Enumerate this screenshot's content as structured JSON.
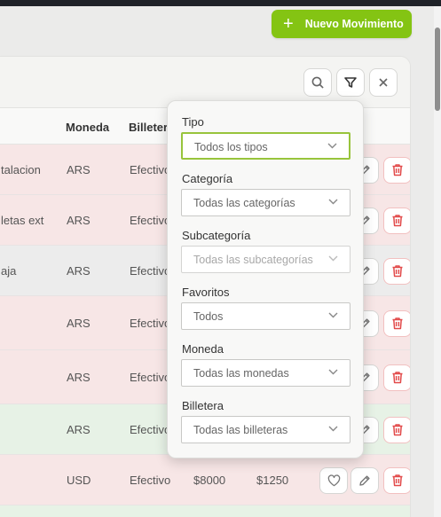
{
  "header": {
    "new_button_label": "Nuevo Movimiento"
  },
  "toolbar": {
    "icons": [
      "search-icon",
      "filter-icon",
      "close-icon"
    ]
  },
  "table": {
    "columns": [
      "Moneda",
      "Billetera"
    ],
    "rows": [
      {
        "desc": "talacion",
        "moneda": "ARS",
        "billetera": "Efectivo",
        "type": "expense"
      },
      {
        "desc": "letas ext",
        "moneda": "ARS",
        "billetera": "Efectivo",
        "type": "expense"
      },
      {
        "desc": "aja",
        "moneda": "ARS",
        "billetera": "Efectivo",
        "type": "neutral"
      },
      {
        "desc": "",
        "moneda": "ARS",
        "billetera": "Efectivo",
        "type": "expense"
      },
      {
        "desc": "",
        "moneda": "ARS",
        "billetera": "Efectivo",
        "type": "expense"
      },
      {
        "desc": "",
        "moneda": "ARS",
        "billetera": "Efectivo",
        "type": "income"
      },
      {
        "desc": "",
        "moneda": "USD",
        "billetera": "Efectivo",
        "amount1": "$8000",
        "amount2": "$1250",
        "type": "expense"
      },
      {
        "desc": "",
        "moneda": "",
        "billetera": "",
        "type": "income"
      }
    ]
  },
  "filters": {
    "tipo": {
      "label": "Tipo",
      "value": "Todos los tipos"
    },
    "categoria": {
      "label": "Categoría",
      "value": "Todas las categorías"
    },
    "subcategoria": {
      "label": "Subcategoría",
      "value": "Todas las subcategorías"
    },
    "favoritos": {
      "label": "Favoritos",
      "value": "Todos"
    },
    "moneda": {
      "label": "Moneda",
      "value": "Todas las monedas"
    },
    "billetera": {
      "label": "Billetera",
      "value": "Todas las billeteras"
    }
  },
  "colors": {
    "accent": "#84c413",
    "expense_row": "#f7e6e6",
    "income_row": "#e7f2e6",
    "neutral_row": "#ececec",
    "delete": "#e24a4a"
  }
}
